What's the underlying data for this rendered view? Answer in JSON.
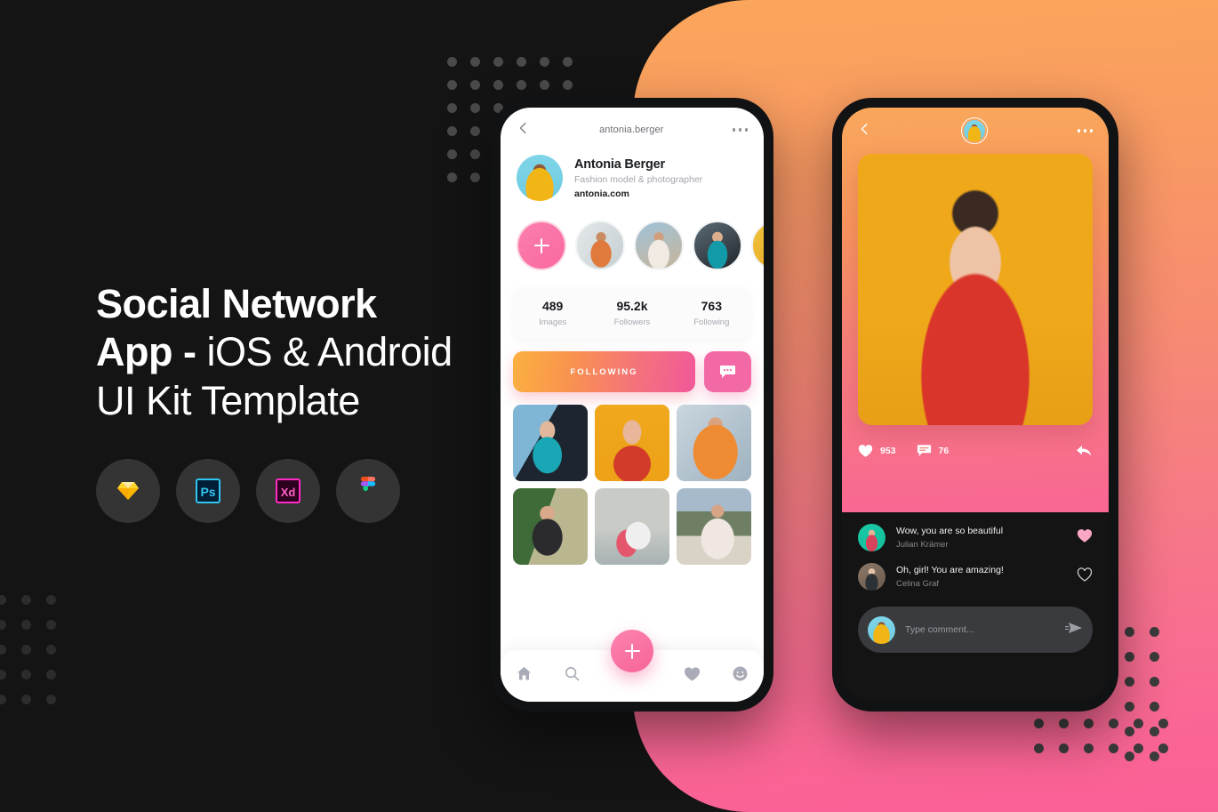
{
  "page": {
    "background_color": "#141414",
    "gradient_start": "#FBA65B",
    "gradient_end": "#FB5F97"
  },
  "hero_copy": {
    "line1": "Social Network",
    "line2_bold": "App -",
    "line2_light": "iOS & Android",
    "line3": "UI Kit Template"
  },
  "tools": [
    {
      "name": "sketch-icon",
      "label": "Sketch"
    },
    {
      "name": "photoshop-icon",
      "label": "Ps"
    },
    {
      "name": "adobe-xd-icon",
      "label": "Xd"
    },
    {
      "name": "figma-icon",
      "label": "Figma"
    }
  ],
  "phone_profile": {
    "topbar": {
      "back": "←",
      "title": "antonia.berger",
      "more": "more-options"
    },
    "profile": {
      "name": "Antonia Berger",
      "bio": "Fashion model & photographer",
      "website": "antonia.com"
    },
    "stories": [
      {
        "label": "Add story",
        "kind": "add"
      },
      {
        "label": "Story 1",
        "kind": "photo"
      },
      {
        "label": "Story 2",
        "kind": "photo"
      },
      {
        "label": "Story 3",
        "kind": "photo"
      },
      {
        "label": "Story 4",
        "kind": "photo"
      }
    ],
    "stats": [
      {
        "value": "489",
        "label": "Images"
      },
      {
        "value": "95.2k",
        "label": "Followers"
      },
      {
        "value": "763",
        "label": "Following"
      }
    ],
    "actions": {
      "follow_label": "FOLLOWING",
      "message_label": "message-icon"
    },
    "grid": [
      {
        "label": "Photo 1 - teal dress"
      },
      {
        "label": "Photo 2 - red top yellow background"
      },
      {
        "label": "Photo 3 - orange dress city"
      },
      {
        "label": "Photo 4 - black top greenery"
      },
      {
        "label": "Photo 5 - couple at beach"
      },
      {
        "label": "Photo 6 - white dress mountains"
      }
    ],
    "tabbar": [
      {
        "name": "home-icon",
        "label": "Home"
      },
      {
        "name": "search-icon",
        "label": "Search"
      },
      {
        "name": "add-icon",
        "label": "Add"
      },
      {
        "name": "heart-icon",
        "label": "Likes"
      },
      {
        "name": "profile-icon",
        "label": "Profile"
      }
    ]
  },
  "phone_post": {
    "topbar": {
      "back": "←",
      "avatar": "user-avatar",
      "more": "more-options"
    },
    "post": {
      "label": "Post photo - red top yellow background"
    },
    "actions": {
      "likes": "953",
      "comments": "76",
      "share": "share-icon"
    },
    "comments": [
      {
        "text": "Wow, you are so beautiful",
        "author": "Julian Krämer",
        "liked": true
      },
      {
        "text": "Oh, girl! You are amazing!",
        "author": "Celina Graf",
        "liked": false
      }
    ],
    "composer": {
      "placeholder": "Type comment...",
      "value": "",
      "send": "send-icon"
    }
  }
}
